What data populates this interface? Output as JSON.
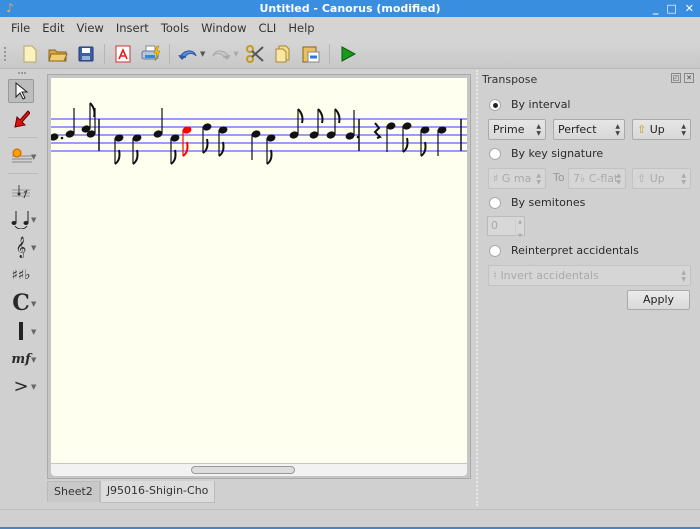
{
  "window": {
    "title": "Untitled - Canorus (modified)",
    "controls": [
      "minimize",
      "maximize",
      "close"
    ]
  },
  "menubar": {
    "items": [
      {
        "label": "File",
        "mnemonic": "F"
      },
      {
        "label": "Edit",
        "mnemonic": "E"
      },
      {
        "label": "View",
        "mnemonic": "V"
      },
      {
        "label": "Insert",
        "mnemonic": "I"
      },
      {
        "label": "Tools",
        "mnemonic": "T"
      },
      {
        "label": "Window",
        "mnemonic": ""
      },
      {
        "label": "CLI",
        "mnemonic": ""
      },
      {
        "label": "Help",
        "mnemonic": "H"
      }
    ]
  },
  "toolbar": {
    "buttons": [
      {
        "name": "new-document",
        "glyph": "🗋"
      },
      {
        "name": "open-folder",
        "glyph": "📂"
      },
      {
        "name": "save",
        "glyph": "💾"
      },
      {
        "name": "export-pdf",
        "glyph": "⎙"
      },
      {
        "name": "print",
        "glyph": "🖶"
      },
      {
        "name": "undo",
        "glyph": "↶"
      },
      {
        "name": "redo",
        "glyph": "↷"
      },
      {
        "name": "cut",
        "glyph": "✂"
      },
      {
        "name": "copy",
        "glyph": "⎘"
      },
      {
        "name": "paste",
        "glyph": "📋"
      },
      {
        "name": "play",
        "glyph": "▶"
      }
    ]
  },
  "lefttoolbar": {
    "tools": [
      {
        "name": "select-mode",
        "glyph": "⇖",
        "active": true
      },
      {
        "name": "insert-mode",
        "glyph": "➘"
      },
      {
        "name": "new-staff",
        "glyph": "☀"
      },
      {
        "name": "insert-rest",
        "glyph": "𝄾"
      },
      {
        "name": "slur",
        "glyph": "⌣"
      },
      {
        "name": "clef",
        "glyph": "𝄞"
      },
      {
        "name": "key-signature",
        "glyph": "♯♭"
      },
      {
        "name": "time-signature",
        "glyph": "C"
      },
      {
        "name": "barline",
        "glyph": "▌"
      },
      {
        "name": "dynamics",
        "glyph": "𝆐"
      },
      {
        "name": "articulation",
        "glyph": ">"
      }
    ]
  },
  "score": {
    "selected_note_color": "#ff0000",
    "staff_line_color": "#3a3aff",
    "background": "#fffff0"
  },
  "sheet_tabs": [
    {
      "label": "Sheet2",
      "active": false
    },
    {
      "label": "J95016-Shigin-Cho",
      "active": true
    }
  ],
  "transpose": {
    "title": "Transpose",
    "by_interval": {
      "label": "By interval",
      "checked": true,
      "interval": "Prime",
      "quality": "Perfect",
      "direction": "Up"
    },
    "by_key_signature": {
      "label": "By key signature",
      "checked": false,
      "from_key": "G ma",
      "to_label": "To",
      "to_key": "C-flat",
      "direction": "Up"
    },
    "by_semitones": {
      "label": "By semitones",
      "checked": false,
      "value": "0"
    },
    "reinterpret": {
      "label": "Reinterpret accidentals",
      "checked": false,
      "option": "Invert accidentals"
    },
    "apply_label": "Apply"
  }
}
